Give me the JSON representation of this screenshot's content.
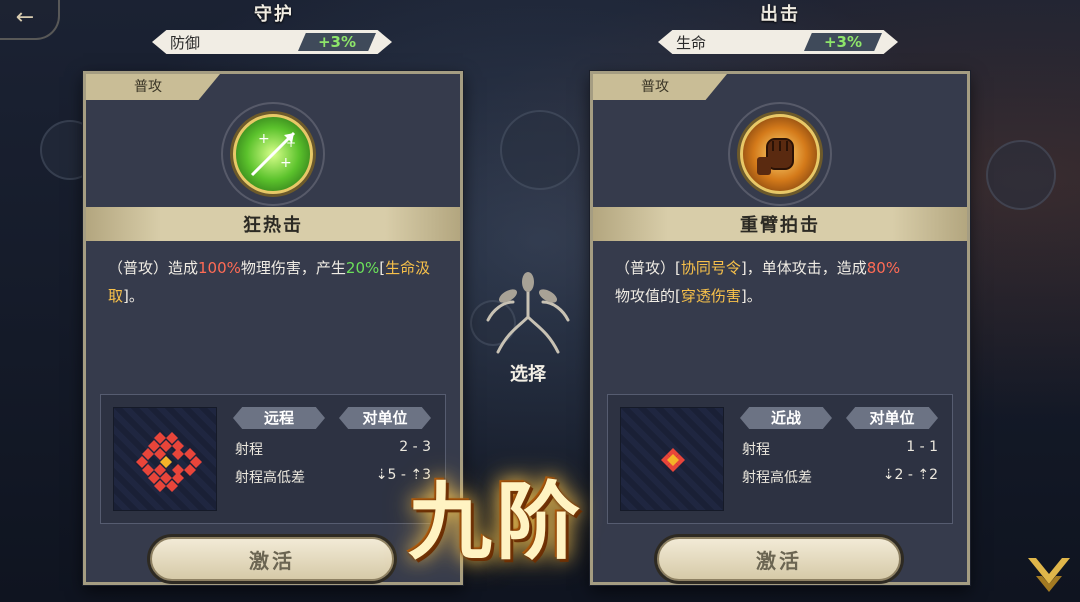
{
  "left": {
    "title": "守护",
    "stat": {
      "label": "防御",
      "value": "+3%"
    },
    "tag": "普攻",
    "skill_name": "狂热击",
    "desc": {
      "p1": "（普攻）造成",
      "v1": "100%",
      "p2": "物理伤害，产生",
      "v2": "20%",
      "p3": "[",
      "link": "生命汲取",
      "p4": "]。"
    },
    "range": {
      "type": "远程",
      "target": "对单位",
      "range_label": "射程",
      "range_value": "2 - 3",
      "height_label": "射程高低差",
      "height_value": "⇣5 - ⇡3"
    },
    "activate": "激活",
    "icon": "arrow-heal-icon",
    "accent": "#6be05a"
  },
  "right": {
    "title": "出击",
    "stat": {
      "label": "生命",
      "value": "+3%"
    },
    "tag": "普攻",
    "skill_name": "重臂拍击",
    "desc": {
      "p1": "（普攻）[",
      "link1": "协同号令",
      "p2": "]，单体攻击，造成",
      "v1": "80%",
      "p3": "物攻值的[",
      "link2": "穿透伤害",
      "p4": "]。"
    },
    "range": {
      "type": "近战",
      "target": "对单位",
      "range_label": "射程",
      "range_value": "1 - 1",
      "height_label": "射程高低差",
      "height_value": "⇣2 - ⇡2"
    },
    "activate": "激活",
    "icon": "fist-icon",
    "accent": "#f7a23a"
  },
  "center": {
    "select_label": "选择",
    "rank": "九阶"
  },
  "colors": {
    "red_value": "#ff6b55",
    "green_value": "#6be05a",
    "gold_link": "#f7c04a",
    "stat_green": "#8ee56a"
  }
}
